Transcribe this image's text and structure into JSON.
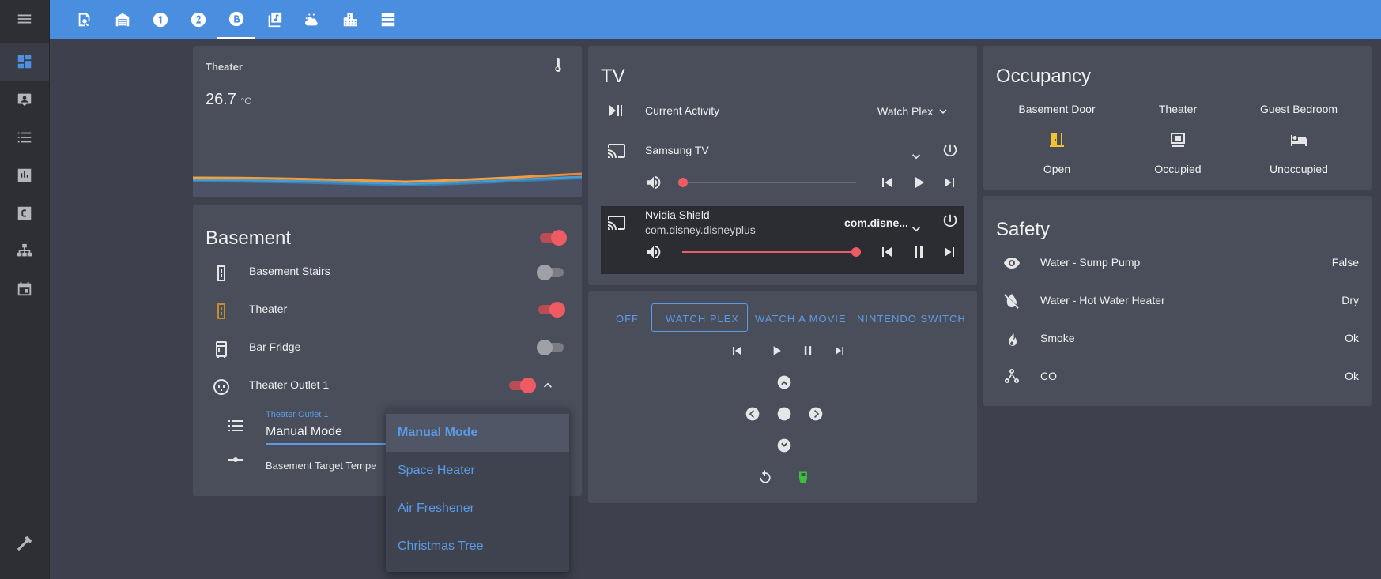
{
  "sidebar": {
    "items": [
      {
        "icon": "menu-icon"
      },
      {
        "icon": "dashboard-icon"
      },
      {
        "icon": "account-box-icon"
      },
      {
        "icon": "list-icon"
      },
      {
        "icon": "chart-icon"
      },
      {
        "icon": "c-box-icon"
      },
      {
        "icon": "sitemap-icon"
      },
      {
        "icon": "calendar-icon"
      },
      {
        "icon": "hammer-icon"
      }
    ]
  },
  "tabs": [
    {
      "icon": "magnify-icon"
    },
    {
      "icon": "garage-icon"
    },
    {
      "icon": "numeric-1-icon",
      "glyph": "1"
    },
    {
      "icon": "numeric-2-icon",
      "glyph": "2"
    },
    {
      "icon": "letter-b-icon",
      "glyph": "B"
    },
    {
      "icon": "music-box-icon"
    },
    {
      "icon": "weather-icon"
    },
    {
      "icon": "city-icon"
    },
    {
      "icon": "server-icon"
    }
  ],
  "theater_sensor": {
    "title": "Theater",
    "value": "26.7",
    "unit": "°C"
  },
  "basement": {
    "title": "Basement",
    "master_on": true,
    "rows": [
      {
        "label": "Basement Stairs",
        "on": false,
        "icon": "light-switch-icon"
      },
      {
        "label": "Theater",
        "on": true,
        "icon": "light-switch-icon"
      },
      {
        "label": "Bar Fridge",
        "on": false,
        "icon": "fridge-icon"
      },
      {
        "label": "Theater Outlet 1",
        "on": true,
        "icon": "power-socket-icon"
      }
    ],
    "select_label": "Theater Outlet 1",
    "select_value": "Manual Mode",
    "target_label": "Basement Target Tempe"
  },
  "dropdown": {
    "options": [
      "Manual Mode",
      "Space Heater",
      "Air Freshener",
      "Christmas Tree"
    ],
    "selected": "Manual Mode"
  },
  "tv": {
    "title": "TV",
    "activity_label": "Current Activity",
    "activity_value": "Watch Plex",
    "samsung": {
      "name": "Samsung TV",
      "volume": 0.0
    },
    "shield": {
      "name": "Nvidia Shield",
      "app": "com.disney.disneyplus",
      "source": "com.disne...",
      "volume": 1.0
    }
  },
  "remote": {
    "buttons": [
      "OFF",
      "WATCH PLEX",
      "WATCH A MOVIE",
      "NINTENDO SWITCH"
    ],
    "active": "WATCH PLEX"
  },
  "occupancy": {
    "title": "Occupancy",
    "items": [
      {
        "name": "Basement Door",
        "state": "Open",
        "icon": "door-open-icon"
      },
      {
        "name": "Theater",
        "state": "Occupied",
        "icon": "theater-icon"
      },
      {
        "name": "Guest Bedroom",
        "state": "Unoccupied",
        "icon": "bed-icon"
      }
    ]
  },
  "safety": {
    "title": "Safety",
    "rows": [
      {
        "label": "Water - Sump Pump",
        "value": "False",
        "icon": "eye-icon"
      },
      {
        "label": "Water - Hot Water Heater",
        "value": "Dry",
        "icon": "water-off-icon"
      },
      {
        "label": "Smoke",
        "value": "Ok",
        "icon": "fire-icon"
      },
      {
        "label": "CO",
        "value": "Ok",
        "icon": "molecule-co-icon"
      }
    ]
  },
  "colors": {
    "accent": "#4a8ee0",
    "card": "#4a4e5b",
    "toggle_on": "#ef5b63",
    "link": "#5b9be6",
    "occupancy_icon": "#f2c230"
  }
}
